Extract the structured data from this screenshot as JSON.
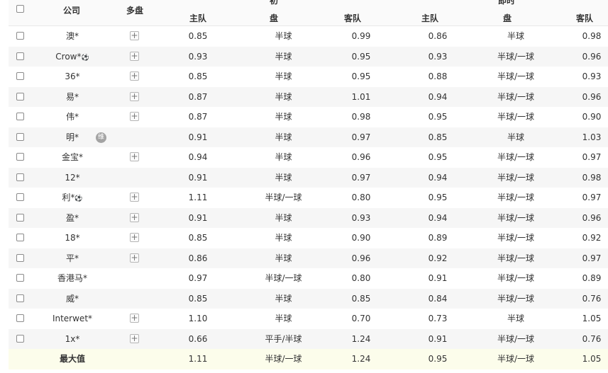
{
  "header": {
    "company": "公司",
    "multi": "多盘",
    "initial_group": "初",
    "initial_pan": "盘",
    "live_group": "即时",
    "live_pan": "盘",
    "home": "主队",
    "away": "客队"
  },
  "rows": [
    {
      "company": "澳*",
      "mark": "",
      "extra": "plus",
      "ih": "0.85",
      "ip": "半球",
      "ia": "0.99",
      "lh": "0.86",
      "lp": "半球",
      "la": "0.98"
    },
    {
      "company": "Crow*",
      "mark": "⚽",
      "extra": "plus",
      "ih": "0.93",
      "ip": "半球",
      "ia": "0.95",
      "lh": "0.93",
      "lp": "半球/一球",
      "la": "0.96"
    },
    {
      "company": "36*",
      "mark": "",
      "extra": "plus",
      "ih": "0.85",
      "ip": "半球",
      "ia": "0.95",
      "lh": "0.88",
      "lp": "半球/一球",
      "la": "0.93"
    },
    {
      "company": "易*",
      "mark": "",
      "extra": "plus",
      "ih": "0.87",
      "ip": "半球",
      "ia": "1.01",
      "lh": "0.94",
      "lp": "半球/一球",
      "la": "0.96"
    },
    {
      "company": "伟*",
      "mark": "",
      "extra": "plus",
      "ih": "0.87",
      "ip": "半球",
      "ia": "0.98",
      "lh": "0.95",
      "lp": "半球/一球",
      "la": "0.90"
    },
    {
      "company": "明*",
      "mark": "",
      "extra": "badge",
      "badge": "维",
      "ih": "0.91",
      "ip": "半球",
      "ia": "0.97",
      "lh": "0.85",
      "lp": "半球",
      "la": "1.03"
    },
    {
      "company": "金宝*",
      "mark": "",
      "extra": "plus",
      "ih": "0.94",
      "ip": "半球",
      "ia": "0.96",
      "lh": "0.95",
      "lp": "半球/一球",
      "la": "0.97"
    },
    {
      "company": "12*",
      "mark": "",
      "extra": "",
      "ih": "0.91",
      "ip": "半球",
      "ia": "0.97",
      "lh": "0.94",
      "lp": "半球/一球",
      "la": "0.98"
    },
    {
      "company": "利*",
      "mark": "⚽",
      "extra": "plus",
      "ih": "1.11",
      "ip": "半球/一球",
      "ia": "0.80",
      "lh": "0.95",
      "lp": "半球/一球",
      "la": "0.97"
    },
    {
      "company": "盈*",
      "mark": "",
      "extra": "plus",
      "ih": "0.91",
      "ip": "半球",
      "ia": "0.93",
      "lh": "0.94",
      "lp": "半球/一球",
      "la": "0.96"
    },
    {
      "company": "18*",
      "mark": "",
      "extra": "plus",
      "ih": "0.85",
      "ip": "半球",
      "ia": "0.90",
      "lh": "0.89",
      "lp": "半球/一球",
      "la": "0.92"
    },
    {
      "company": "平*",
      "mark": "",
      "extra": "plus",
      "ih": "0.86",
      "ip": "半球",
      "ia": "0.96",
      "lh": "0.92",
      "lp": "半球/一球",
      "la": "0.97"
    },
    {
      "company": "香港马*",
      "mark": "",
      "extra": "",
      "ih": "0.97",
      "ip": "半球/一球",
      "ia": "0.80",
      "lh": "0.91",
      "lp": "半球/一球",
      "la": "0.89"
    },
    {
      "company": "威*",
      "mark": "",
      "extra": "",
      "ih": "0.85",
      "ip": "半球",
      "ia": "0.85",
      "lh": "0.84",
      "lp": "半球/一球",
      "la": "0.76"
    },
    {
      "company": "Interwet*",
      "mark": "",
      "extra": "plus",
      "ih": "1.10",
      "ip": "半球",
      "ia": "0.70",
      "lh": "0.73",
      "lp": "半球",
      "la": "1.05"
    },
    {
      "company": "1x*",
      "mark": "",
      "extra": "plus",
      "ih": "0.66",
      "ip": "平手/半球",
      "ia": "1.24",
      "lh": "0.91",
      "lp": "半球/一球",
      "la": "0.76"
    }
  ],
  "max_row": {
    "label": "最大值",
    "ih": "1.11",
    "ip": "半球/一球",
    "ia": "1.24",
    "lh": "0.95",
    "lp": "半球/一球",
    "la": "1.05"
  },
  "icons": {
    "plus": "plus-expand-icon",
    "ball": "football-icon",
    "badge": "maintenance-badge-icon"
  },
  "colors": {
    "alt_row": "#f6f6f6",
    "max_row": "#fcfdeb",
    "badge": "#a3a3a3"
  }
}
